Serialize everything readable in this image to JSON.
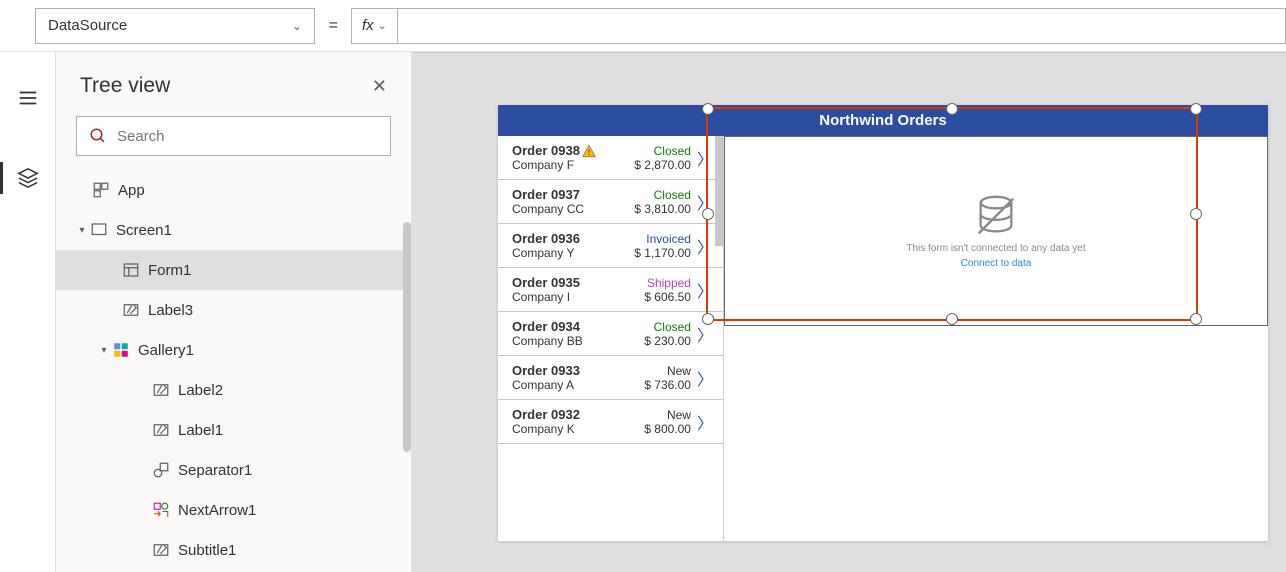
{
  "formula": {
    "property": "DataSource",
    "equals": "=",
    "fx_label": "fx",
    "value": ""
  },
  "tree": {
    "title": "Tree view",
    "search_placeholder": "Search",
    "items": [
      {
        "label": "App",
        "icon": "app",
        "depth": 0,
        "expand": ""
      },
      {
        "label": "Screen1",
        "icon": "screen",
        "depth": 1,
        "expand": "▾"
      },
      {
        "label": "Form1",
        "icon": "form",
        "depth": 2,
        "expand": "",
        "selected": true
      },
      {
        "label": "Label3",
        "icon": "label",
        "depth": 2,
        "expand": ""
      },
      {
        "label": "Gallery1",
        "icon": "gallery",
        "depth": 3,
        "expand": "▾"
      },
      {
        "label": "Label2",
        "icon": "label",
        "depth": 4,
        "expand": ""
      },
      {
        "label": "Label1",
        "icon": "label",
        "depth": 4,
        "expand": ""
      },
      {
        "label": "Separator1",
        "icon": "separator",
        "depth": 4,
        "expand": ""
      },
      {
        "label": "NextArrow1",
        "icon": "nextarrow",
        "depth": 4,
        "expand": ""
      },
      {
        "label": "Subtitle1",
        "icon": "label",
        "depth": 4,
        "expand": ""
      }
    ]
  },
  "app": {
    "title": "Northwind Orders",
    "form_empty_msg": "This form isn't connected to any data yet",
    "form_empty_link": "Connect to data",
    "gallery": [
      {
        "order": "Order 0938",
        "company": "Company F",
        "status": "Closed",
        "price": "$ 2,870.00",
        "warn": true
      },
      {
        "order": "Order 0937",
        "company": "Company CC",
        "status": "Closed",
        "price": "$ 3,810.00",
        "warn": false
      },
      {
        "order": "Order 0936",
        "company": "Company Y",
        "status": "Invoiced",
        "price": "$ 1,170.00",
        "warn": false
      },
      {
        "order": "Order 0935",
        "company": "Company I",
        "status": "Shipped",
        "price": "$ 606.50",
        "warn": false
      },
      {
        "order": "Order 0934",
        "company": "Company BB",
        "status": "Closed",
        "price": "$ 230.00",
        "warn": false
      },
      {
        "order": "Order 0933",
        "company": "Company A",
        "status": "New",
        "price": "$ 736.00",
        "warn": false
      },
      {
        "order": "Order 0932",
        "company": "Company K",
        "status": "New",
        "price": "$ 800.00",
        "warn": false
      }
    ]
  }
}
